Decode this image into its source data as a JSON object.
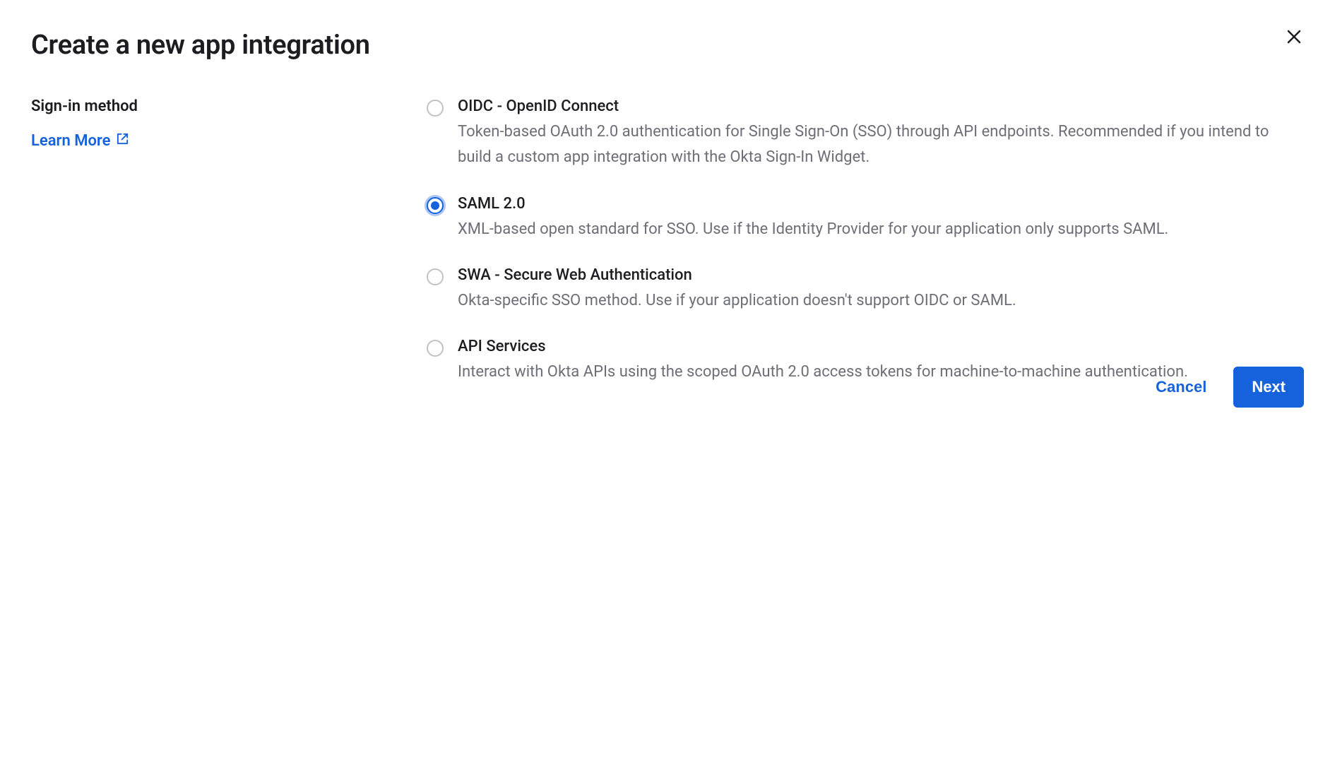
{
  "modal": {
    "title": "Create a new app integration"
  },
  "sidebar": {
    "section_label": "Sign-in method",
    "learn_more": "Learn More"
  },
  "options": [
    {
      "id": "oidc",
      "title": "OIDC - OpenID Connect",
      "description": "Token-based OAuth 2.0 authentication for Single Sign-On (SSO) through API endpoints. Recommended if you intend to build a custom app integration with the Okta Sign-In Widget.",
      "selected": false
    },
    {
      "id": "saml",
      "title": "SAML 2.0",
      "description": "XML-based open standard for SSO. Use if the Identity Provider for your application only supports SAML.",
      "selected": true
    },
    {
      "id": "swa",
      "title": "SWA - Secure Web Authentication",
      "description": "Okta-specific SSO method. Use if your application doesn't support OIDC or SAML.",
      "selected": false
    },
    {
      "id": "api",
      "title": "API Services",
      "description": "Interact with Okta APIs using the scoped OAuth 2.0 access tokens for machine-to-machine authentication.",
      "selected": false
    }
  ],
  "footer": {
    "cancel": "Cancel",
    "next": "Next"
  },
  "colors": {
    "primary": "#1662dd",
    "text": "#1d1d21",
    "muted": "#6e6e78",
    "border": "#c1c1c8"
  }
}
